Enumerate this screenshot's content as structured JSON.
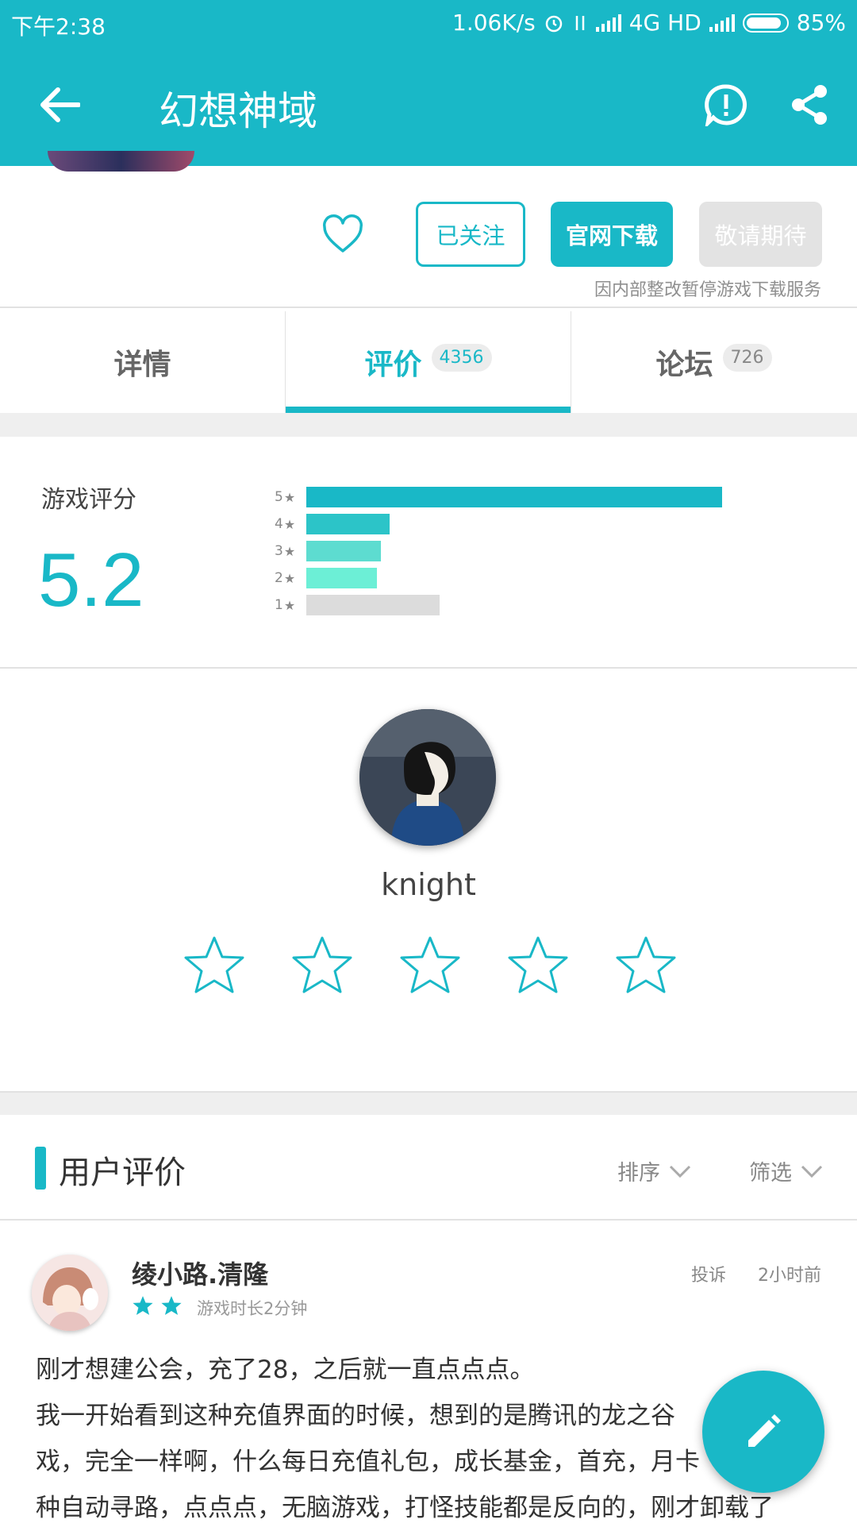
{
  "status_bar": {
    "time": "下午2:38",
    "speed": "1.06K/s",
    "network": "4G HD",
    "battery": "85%"
  },
  "app_bar": {
    "title": "幻想神域",
    "icons": [
      "back-arrow-icon",
      "report-icon",
      "share-icon"
    ]
  },
  "header": {
    "follow_label": "已关注",
    "download_label": "官网下载",
    "wait_label": "敬请期待",
    "notice": "因内部整改暂停游戏下载服务"
  },
  "tabs": [
    {
      "label": "详情",
      "count": ""
    },
    {
      "label": "评价",
      "count": "4356"
    },
    {
      "label": "论坛",
      "count": "726"
    }
  ],
  "rating": {
    "label": "游戏评分",
    "score": "5.2",
    "distribution": [
      {
        "stars": "5",
        "fraction": 1.0,
        "color": "#19b8c7"
      },
      {
        "stars": "4",
        "fraction": 0.2,
        "color": "#2cc4c8"
      },
      {
        "stars": "3",
        "fraction": 0.18,
        "color": "#5ddcd0"
      },
      {
        "stars": "2",
        "fraction": 0.17,
        "color": "#6cefd6"
      },
      {
        "stars": "1",
        "fraction": 0.32,
        "color": "#dcdcdc"
      }
    ]
  },
  "user": {
    "name": "knight",
    "star_count": 5
  },
  "reviews": {
    "title": "用户评价",
    "sort_label": "排序",
    "filter_label": "筛选",
    "items": [
      {
        "name": "绫小路.清隆",
        "stars": 2,
        "playtime": "游戏时长2分钟",
        "report": "投诉",
        "time": "2小时前",
        "text_lines": [
          "刚才想建公会，充了28，之后就一直点点点。",
          "我一开始看到这种充值界面的时候，想到的是腾讯的龙之谷",
          "戏，完全一样啊，什么每日充值礼包，成长基金，首充，月卡",
          "种自动寻路，点点点，无脑游戏，打怪技能都是反向的，刚才卸载了"
        ]
      }
    ]
  },
  "colors": {
    "accent": "#19b8c7",
    "disabled": "#e3e3e3"
  }
}
